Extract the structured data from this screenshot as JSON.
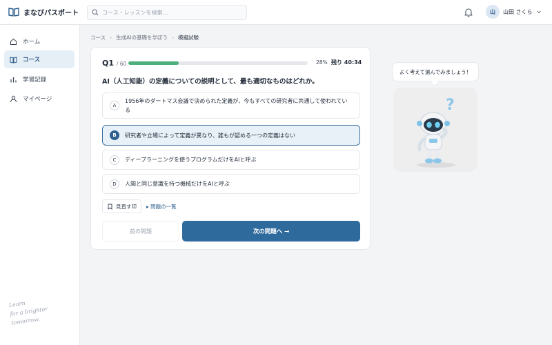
{
  "app": {
    "name": "まなびパスポート"
  },
  "search": {
    "placeholder": "コース・レッスンを検索…"
  },
  "user": {
    "initial": "山",
    "name": "山田 さくら"
  },
  "sidebar": {
    "items": [
      {
        "label": "ホーム",
        "icon": "home-icon",
        "active": false
      },
      {
        "label": "コース",
        "icon": "book-icon",
        "active": true
      },
      {
        "label": "学習記録",
        "icon": "bar-chart-icon",
        "active": false
      },
      {
        "label": "マイページ",
        "icon": "user-icon",
        "active": false
      }
    ],
    "tagline": [
      "Learn",
      "for a brighter",
      "tomorrow."
    ]
  },
  "breadcrumb": [
    "コース",
    "生成AIの基礎を学ぼう",
    "模擬試験"
  ],
  "quiz": {
    "qlabel": "Q1",
    "total": "/ 60",
    "progress_pct": 28,
    "progress_text": "28%",
    "remaining": "残り 40:34",
    "question": "AI（人工知能）の定義についての説明として、最も適切なものはどれか。",
    "options": [
      {
        "letter": "A",
        "text": "1956年のダートマス会議で決められた定義が、今もすべての研究者に共通して使われている",
        "selected": false
      },
      {
        "letter": "B",
        "text": "研究者や立場によって定義が異なり、誰もが認める一つの定義はない",
        "selected": true
      },
      {
        "letter": "C",
        "text": "ディープラーニングを使うプログラムだけをAIと呼ぶ",
        "selected": false
      },
      {
        "letter": "D",
        "text": "人間と同じ意識を持つ機械だけをAIと呼ぶ",
        "selected": false
      }
    ],
    "bookmark_label": "見直す印",
    "list_label": "▸ 問題の一覧",
    "prev_label": "前の問題",
    "next_label": "次の問題へ →"
  },
  "mascot": {
    "speech": "よく考えて選んでみましょう！",
    "question_mark": "?"
  },
  "colors": {
    "accent": "#2f6a9c",
    "progress": "#4caf7c",
    "selected_bg": "#e9f1f8"
  }
}
